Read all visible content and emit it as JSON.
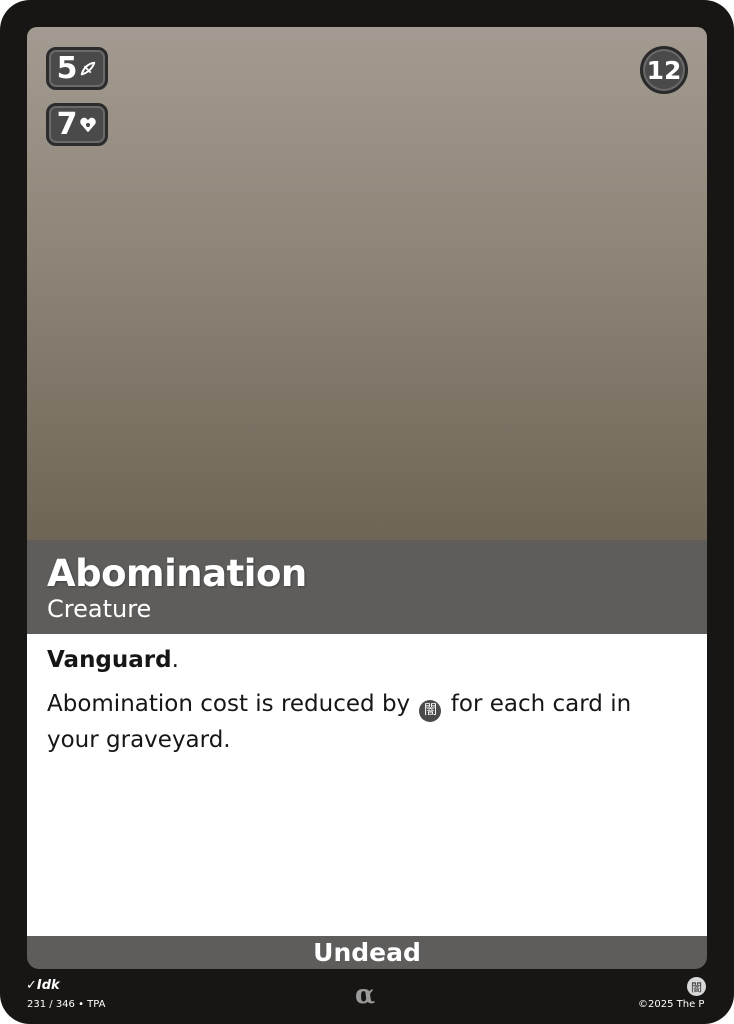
{
  "card": {
    "name": "Abomination",
    "type": "Creature",
    "cost": "12",
    "power": "5",
    "health": "7",
    "power_icon": "blade-icon",
    "health_icon": "heart-icon",
    "keyword": "Vanguard",
    "keyword_punct": ".",
    "rules_before": "Abomination cost is reduced by",
    "rules_glyph": "闇",
    "rules_after": "for each card in your graveyard.",
    "subtype": "Undead"
  },
  "footer": {
    "artist": "Idk",
    "set_info": "231 / 346 • TPA",
    "rarity": "α",
    "element_glyph": "闇",
    "copyright": "©2025 The P"
  },
  "colors": {
    "frame": "#181614",
    "bar": "#5e5d5b",
    "art_top": "#a39b91",
    "art_bottom": "#6e6556",
    "badge": "#4a4a4a"
  }
}
